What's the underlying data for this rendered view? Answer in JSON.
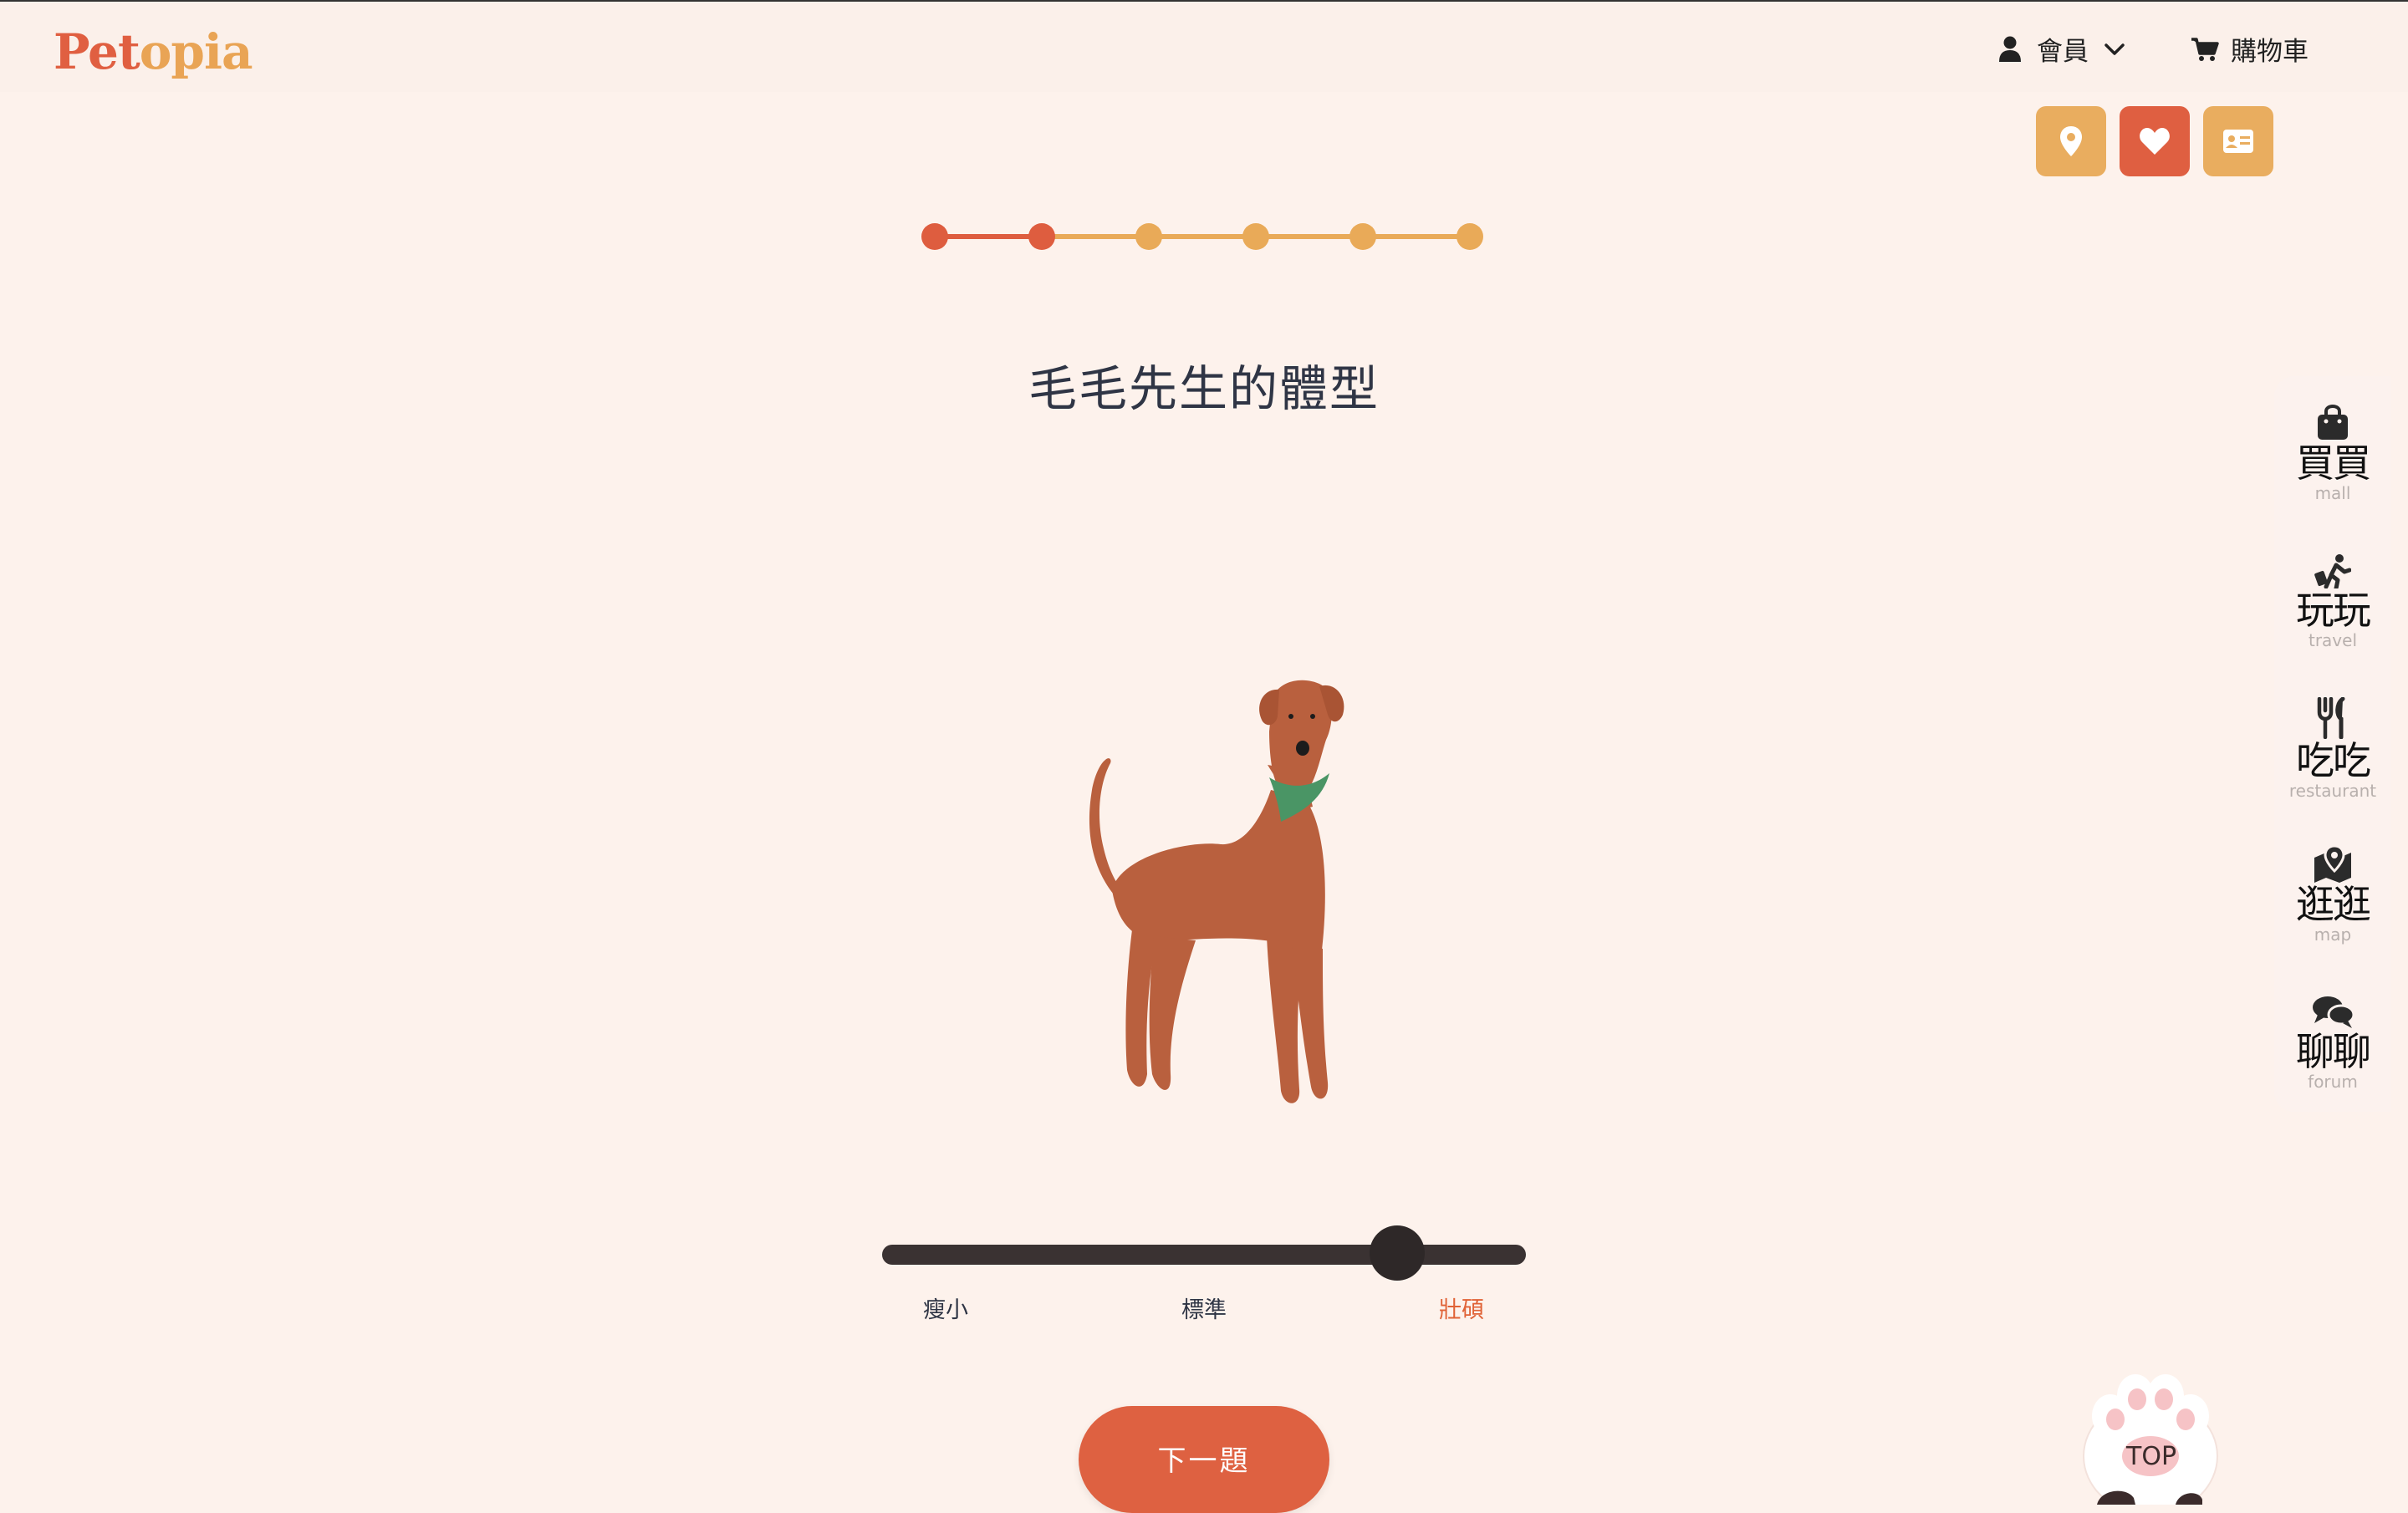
{
  "brand": {
    "logo_part1": "Pet",
    "logo_part2": "opia"
  },
  "header": {
    "member_label": "會員",
    "cart_label": "購物車"
  },
  "quick_buttons": [
    {
      "icon": "map-pin-icon",
      "color": "#e9ad5f"
    },
    {
      "icon": "heart-icon",
      "color": "#df5f41"
    },
    {
      "icon": "id-card-icon",
      "color": "#e9ad5f"
    }
  ],
  "progress": {
    "total_steps": 6,
    "current_step": 2,
    "done_color": "#de5d3f",
    "todo_color": "#e9aa58"
  },
  "question": {
    "title": "毛毛先生的體型"
  },
  "slider": {
    "labels": [
      "瘦小",
      "標準",
      "壯碩"
    ],
    "selected_index": 2,
    "value_fraction": 0.8
  },
  "next_button_label": "下一題",
  "sidebar": {
    "items": [
      {
        "zh": "買買",
        "en": "mall",
        "icon": "shopping-bag-icon"
      },
      {
        "zh": "玩玩",
        "en": "travel",
        "icon": "traveler-icon"
      },
      {
        "zh": "吃吃",
        "en": "restaurant",
        "icon": "utensils-icon"
      },
      {
        "zh": "逛逛",
        "en": "map",
        "icon": "map-marker-icon"
      },
      {
        "zh": "聊聊",
        "en": "forum",
        "icon": "chat-bubbles-icon"
      }
    ]
  },
  "back_to_top_label": "TOP",
  "colors": {
    "accent": "#de6141",
    "secondary": "#e9ad5f",
    "background": "#fdf2ec",
    "dog": "#b9603e",
    "bandana": "#4a9565"
  }
}
